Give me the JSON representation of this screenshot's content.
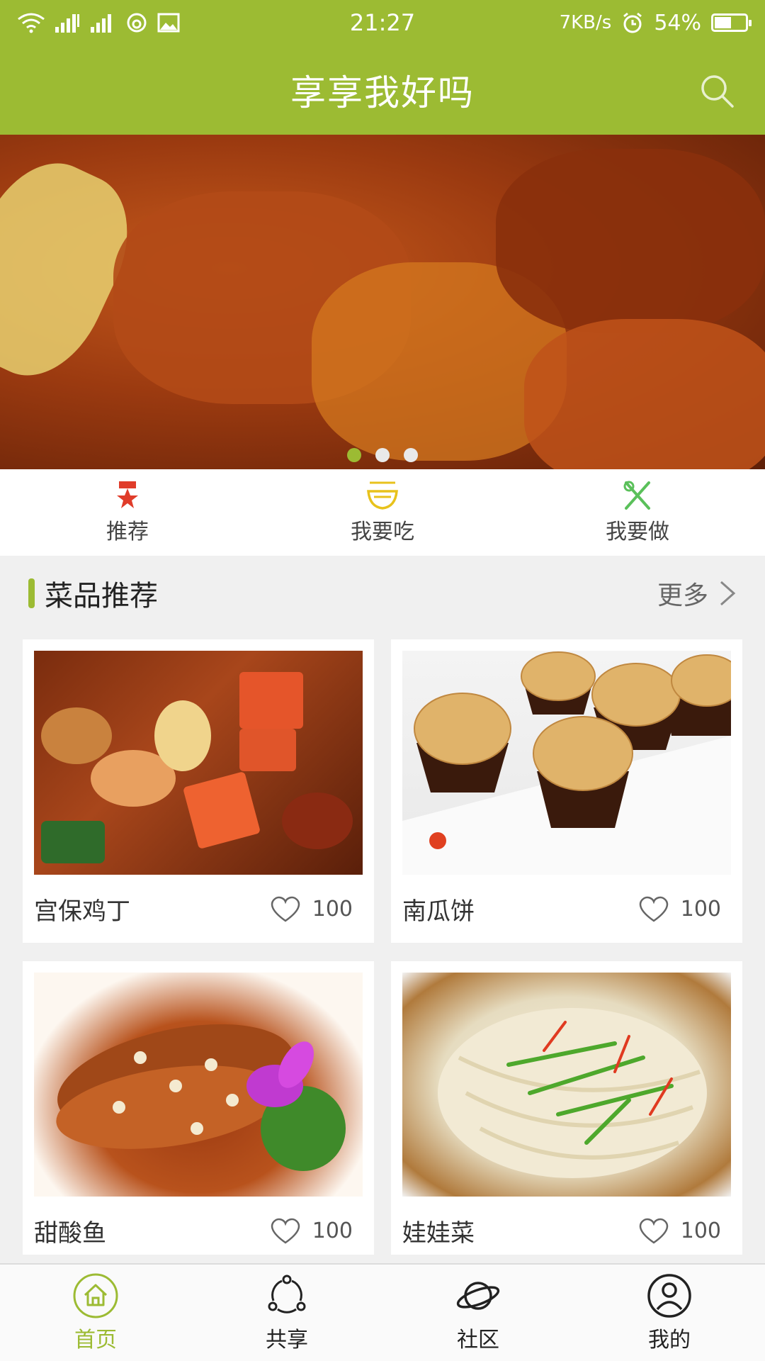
{
  "status_bar": {
    "time": "21:27",
    "net_speed": "7KB/s",
    "battery_percent": "54%",
    "battery_level": 0.54,
    "icons": [
      "wifi-icon",
      "signal-icon",
      "signal-icon",
      "weibo-icon",
      "image-icon",
      "alarm-icon",
      "battery-icon"
    ]
  },
  "header": {
    "title": "享享我好吗",
    "search_icon": "search-icon"
  },
  "banner": {
    "slides": 3,
    "active_slide": 0
  },
  "categories": [
    {
      "label": "推荐",
      "icon": "star-badge-icon",
      "color": "#e03c2a"
    },
    {
      "label": "我要吃",
      "icon": "bowl-icon",
      "color": "#e8c21c"
    },
    {
      "label": "我要做",
      "icon": "utensils-icon",
      "color": "#5ac05a"
    }
  ],
  "section": {
    "title": "菜品推荐",
    "more_label": "更多"
  },
  "dishes": [
    {
      "name": "宫保鸡丁",
      "likes": "100"
    },
    {
      "name": "南瓜饼",
      "likes": "100"
    },
    {
      "name": "甜酸鱼",
      "likes": "100"
    },
    {
      "name": "娃娃菜",
      "likes": "100"
    }
  ],
  "bottom_nav": [
    {
      "label": "首页",
      "icon": "home-icon",
      "active": true
    },
    {
      "label": "共享",
      "icon": "share-icon",
      "active": false
    },
    {
      "label": "社区",
      "icon": "planet-icon",
      "active": false
    },
    {
      "label": "我的",
      "icon": "user-icon",
      "active": false
    }
  ],
  "colors": {
    "accent": "#9cbb33",
    "background": "#f0f0f0"
  }
}
